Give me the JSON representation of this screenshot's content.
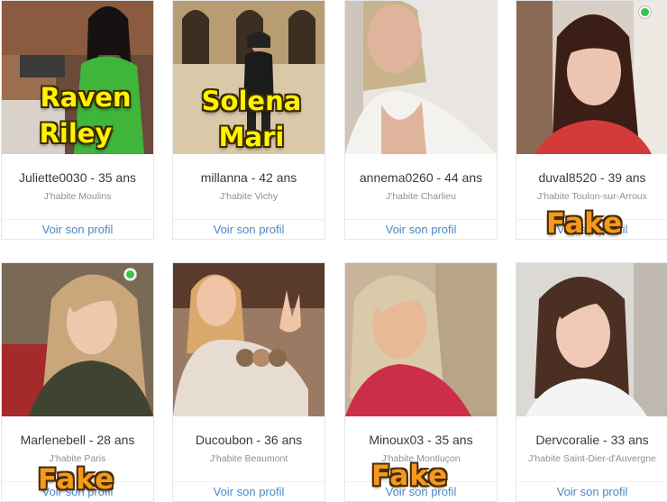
{
  "profiles": [
    {
      "name_age": "Juliette0030 - 35 ans",
      "location": "J'habite Moulins",
      "link": "Voir son profil"
    },
    {
      "name_age": "millanna - 42 ans",
      "location": "J'habite Vichy",
      "link": "Voir son profil"
    },
    {
      "name_age": "annema0260 - 44 ans",
      "location": "J'habite Charlieu",
      "link": "Voir son profil"
    },
    {
      "name_age": "duval8520 - 39 ans",
      "location": "J'habite Toulon-sur-Arroux",
      "link": "Voir son profil"
    },
    {
      "name_age": "Marlenebell - 28 ans",
      "location": "J'habite Paris",
      "link": "Voir son profil"
    },
    {
      "name_age": "Ducoubon - 36 ans",
      "location": "J'habite Beaumont",
      "link": "Voir son profil"
    },
    {
      "name_age": "Minoux03 - 35 ans",
      "location": "J'habite Montluçon",
      "link": "Voir son profil"
    },
    {
      "name_age": "Dervcoralie - 33 ans",
      "location": "J'habite Saint-Dier-d'Auvergne",
      "link": "Voir son profil"
    }
  ],
  "overlays": {
    "raven_line1": "Raven",
    "raven_line2": "Riley",
    "solena_line1": "Solena",
    "solena_line2": "Mari",
    "fake_label": "Fake"
  },
  "colors": {
    "link": "#4a88c7",
    "online_dot": "#3fbf4f",
    "overlay_name": "#fff200",
    "fake_label": "#f39a1c"
  }
}
